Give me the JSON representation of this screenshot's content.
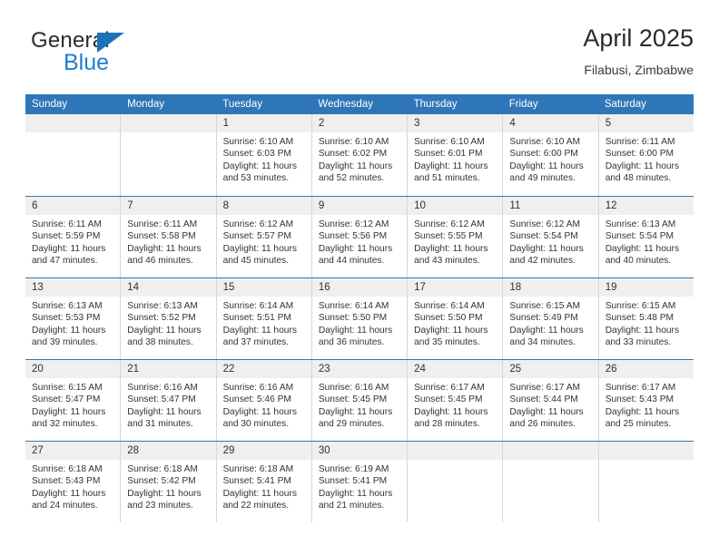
{
  "brand": {
    "word_top": "General",
    "word_bottom": "Blue",
    "accent_color": "#1b72b8",
    "blue_text_color": "#1b7fd4",
    "triangle_icon": "triangle-icon"
  },
  "header": {
    "title": "April 2025",
    "subtitle": "Filabusi, Zimbabwe"
  },
  "theme": {
    "header_bar_color": "#2e76b8",
    "daynum_strip_color": "#efefef",
    "cell_border_color": "#d6d6d6",
    "text_color": "#333333"
  },
  "weekdays": [
    "Sunday",
    "Monday",
    "Tuesday",
    "Wednesday",
    "Thursday",
    "Friday",
    "Saturday"
  ],
  "weeks": [
    [
      {
        "day": "",
        "empty": true,
        "lines": []
      },
      {
        "day": "",
        "empty": true,
        "lines": []
      },
      {
        "day": "1",
        "empty": false,
        "lines": [
          "Sunrise: 6:10 AM",
          "Sunset: 6:03 PM",
          "Daylight: 11 hours",
          "and 53 minutes."
        ]
      },
      {
        "day": "2",
        "empty": false,
        "lines": [
          "Sunrise: 6:10 AM",
          "Sunset: 6:02 PM",
          "Daylight: 11 hours",
          "and 52 minutes."
        ]
      },
      {
        "day": "3",
        "empty": false,
        "lines": [
          "Sunrise: 6:10 AM",
          "Sunset: 6:01 PM",
          "Daylight: 11 hours",
          "and 51 minutes."
        ]
      },
      {
        "day": "4",
        "empty": false,
        "lines": [
          "Sunrise: 6:10 AM",
          "Sunset: 6:00 PM",
          "Daylight: 11 hours",
          "and 49 minutes."
        ]
      },
      {
        "day": "5",
        "empty": false,
        "lines": [
          "Sunrise: 6:11 AM",
          "Sunset: 6:00 PM",
          "Daylight: 11 hours",
          "and 48 minutes."
        ]
      }
    ],
    [
      {
        "day": "6",
        "empty": false,
        "lines": [
          "Sunrise: 6:11 AM",
          "Sunset: 5:59 PM",
          "Daylight: 11 hours",
          "and 47 minutes."
        ]
      },
      {
        "day": "7",
        "empty": false,
        "lines": [
          "Sunrise: 6:11 AM",
          "Sunset: 5:58 PM",
          "Daylight: 11 hours",
          "and 46 minutes."
        ]
      },
      {
        "day": "8",
        "empty": false,
        "lines": [
          "Sunrise: 6:12 AM",
          "Sunset: 5:57 PM",
          "Daylight: 11 hours",
          "and 45 minutes."
        ]
      },
      {
        "day": "9",
        "empty": false,
        "lines": [
          "Sunrise: 6:12 AM",
          "Sunset: 5:56 PM",
          "Daylight: 11 hours",
          "and 44 minutes."
        ]
      },
      {
        "day": "10",
        "empty": false,
        "lines": [
          "Sunrise: 6:12 AM",
          "Sunset: 5:55 PM",
          "Daylight: 11 hours",
          "and 43 minutes."
        ]
      },
      {
        "day": "11",
        "empty": false,
        "lines": [
          "Sunrise: 6:12 AM",
          "Sunset: 5:54 PM",
          "Daylight: 11 hours",
          "and 42 minutes."
        ]
      },
      {
        "day": "12",
        "empty": false,
        "lines": [
          "Sunrise: 6:13 AM",
          "Sunset: 5:54 PM",
          "Daylight: 11 hours",
          "and 40 minutes."
        ]
      }
    ],
    [
      {
        "day": "13",
        "empty": false,
        "lines": [
          "Sunrise: 6:13 AM",
          "Sunset: 5:53 PM",
          "Daylight: 11 hours",
          "and 39 minutes."
        ]
      },
      {
        "day": "14",
        "empty": false,
        "lines": [
          "Sunrise: 6:13 AM",
          "Sunset: 5:52 PM",
          "Daylight: 11 hours",
          "and 38 minutes."
        ]
      },
      {
        "day": "15",
        "empty": false,
        "lines": [
          "Sunrise: 6:14 AM",
          "Sunset: 5:51 PM",
          "Daylight: 11 hours",
          "and 37 minutes."
        ]
      },
      {
        "day": "16",
        "empty": false,
        "lines": [
          "Sunrise: 6:14 AM",
          "Sunset: 5:50 PM",
          "Daylight: 11 hours",
          "and 36 minutes."
        ]
      },
      {
        "day": "17",
        "empty": false,
        "lines": [
          "Sunrise: 6:14 AM",
          "Sunset: 5:50 PM",
          "Daylight: 11 hours",
          "and 35 minutes."
        ]
      },
      {
        "day": "18",
        "empty": false,
        "lines": [
          "Sunrise: 6:15 AM",
          "Sunset: 5:49 PM",
          "Daylight: 11 hours",
          "and 34 minutes."
        ]
      },
      {
        "day": "19",
        "empty": false,
        "lines": [
          "Sunrise: 6:15 AM",
          "Sunset: 5:48 PM",
          "Daylight: 11 hours",
          "and 33 minutes."
        ]
      }
    ],
    [
      {
        "day": "20",
        "empty": false,
        "lines": [
          "Sunrise: 6:15 AM",
          "Sunset: 5:47 PM",
          "Daylight: 11 hours",
          "and 32 minutes."
        ]
      },
      {
        "day": "21",
        "empty": false,
        "lines": [
          "Sunrise: 6:16 AM",
          "Sunset: 5:47 PM",
          "Daylight: 11 hours",
          "and 31 minutes."
        ]
      },
      {
        "day": "22",
        "empty": false,
        "lines": [
          "Sunrise: 6:16 AM",
          "Sunset: 5:46 PM",
          "Daylight: 11 hours",
          "and 30 minutes."
        ]
      },
      {
        "day": "23",
        "empty": false,
        "lines": [
          "Sunrise: 6:16 AM",
          "Sunset: 5:45 PM",
          "Daylight: 11 hours",
          "and 29 minutes."
        ]
      },
      {
        "day": "24",
        "empty": false,
        "lines": [
          "Sunrise: 6:17 AM",
          "Sunset: 5:45 PM",
          "Daylight: 11 hours",
          "and 28 minutes."
        ]
      },
      {
        "day": "25",
        "empty": false,
        "lines": [
          "Sunrise: 6:17 AM",
          "Sunset: 5:44 PM",
          "Daylight: 11 hours",
          "and 26 minutes."
        ]
      },
      {
        "day": "26",
        "empty": false,
        "lines": [
          "Sunrise: 6:17 AM",
          "Sunset: 5:43 PM",
          "Daylight: 11 hours",
          "and 25 minutes."
        ]
      }
    ],
    [
      {
        "day": "27",
        "empty": false,
        "lines": [
          "Sunrise: 6:18 AM",
          "Sunset: 5:43 PM",
          "Daylight: 11 hours",
          "and 24 minutes."
        ]
      },
      {
        "day": "28",
        "empty": false,
        "lines": [
          "Sunrise: 6:18 AM",
          "Sunset: 5:42 PM",
          "Daylight: 11 hours",
          "and 23 minutes."
        ]
      },
      {
        "day": "29",
        "empty": false,
        "lines": [
          "Sunrise: 6:18 AM",
          "Sunset: 5:41 PM",
          "Daylight: 11 hours",
          "and 22 minutes."
        ]
      },
      {
        "day": "30",
        "empty": false,
        "lines": [
          "Sunrise: 6:19 AM",
          "Sunset: 5:41 PM",
          "Daylight: 11 hours",
          "and 21 minutes."
        ]
      },
      {
        "day": "",
        "empty": true,
        "lines": []
      },
      {
        "day": "",
        "empty": true,
        "lines": []
      },
      {
        "day": "",
        "empty": true,
        "lines": []
      }
    ]
  ]
}
